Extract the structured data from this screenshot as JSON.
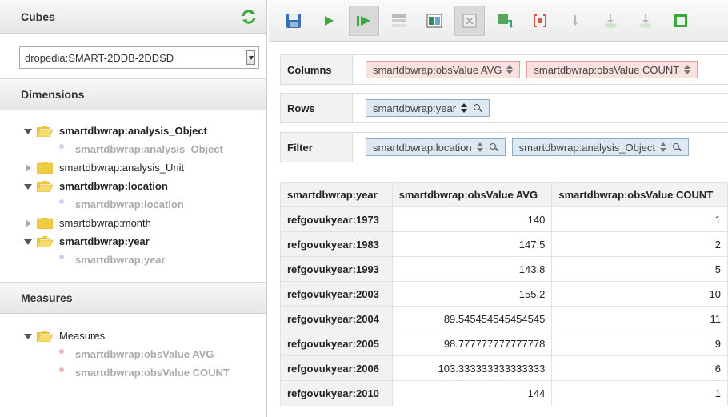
{
  "cubes": {
    "title": "Cubes",
    "selected": "dropedia:SMART-2DDB-2DDSD"
  },
  "dimensions": {
    "title": "Dimensions",
    "items": [
      {
        "label": "smartdbwrap:analysis_Object",
        "expanded": true,
        "bold": true,
        "child": "smartdbwrap:analysis_Object"
      },
      {
        "label": "smartdbwrap:analysis_Unit",
        "expanded": false,
        "bold": false
      },
      {
        "label": "smartdbwrap:location",
        "expanded": true,
        "bold": true,
        "child": "smartdbwrap:location"
      },
      {
        "label": "smartdbwrap:month",
        "expanded": false,
        "bold": false
      },
      {
        "label": "smartdbwrap:year",
        "expanded": true,
        "bold": true,
        "child": "smartdbwrap:year"
      }
    ]
  },
  "measures": {
    "title": "Measures",
    "folder": "Measures",
    "items": [
      "smartdbwrap:obsValue AVG",
      "smartdbwrap:obsValue COUNT"
    ]
  },
  "toolbar": {
    "icons": [
      "save-icon",
      "run-icon",
      "auto-run-icon",
      "toggle-fields-icon",
      "hide-parents-icon",
      "non-empty-icon",
      "swap-axes-icon",
      "mdx-icon",
      "sort-asc-icon",
      "export-icon",
      "export-csv-icon",
      "export-xls-icon"
    ]
  },
  "axes": {
    "columns": {
      "label": "Columns",
      "chips": [
        "smartdbwrap:obsValue AVG",
        "smartdbwrap:obsValue COUNT"
      ]
    },
    "rows": {
      "label": "Rows",
      "chips": [
        "smartdbwrap:year"
      ]
    },
    "filter": {
      "label": "Filter",
      "chips": [
        "smartdbwrap:location",
        "smartdbwrap:analysis_Object"
      ]
    }
  },
  "table": {
    "headers": [
      "smartdbwrap:year",
      "smartdbwrap:obsValue AVG",
      "smartdbwrap:obsValue COUNT"
    ],
    "rows": [
      [
        "refgovukyear:1973",
        "140",
        "1"
      ],
      [
        "refgovukyear:1983",
        "147.5",
        "2"
      ],
      [
        "refgovukyear:1993",
        "143.8",
        "5"
      ],
      [
        "refgovukyear:2003",
        "155.2",
        "10"
      ],
      [
        "refgovukyear:2004",
        "89.545454545454545",
        "11"
      ],
      [
        "refgovukyear:2005",
        "98.777777777777778",
        "9"
      ],
      [
        "refgovukyear:2006",
        "103.333333333333333",
        "6"
      ],
      [
        "refgovukyear:2010",
        "144",
        "1"
      ]
    ]
  },
  "colors": {
    "measure_chip": "#fbe0e0",
    "dimension_chip": "#dde8f3",
    "accent_green": "#3aa83a"
  }
}
